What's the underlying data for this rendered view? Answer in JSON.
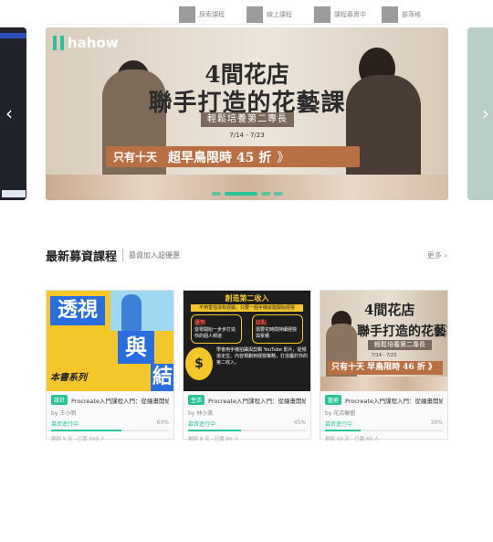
{
  "nav": {
    "items": [
      {
        "label": "探索課程"
      },
      {
        "label": "線上課程"
      },
      {
        "label": "課程募資中"
      },
      {
        "label": "部落格"
      }
    ]
  },
  "carousel": {
    "left_arrow": "‹",
    "right_arrow": "›",
    "banner": {
      "logo": "hahow",
      "title_line1": "4間花店",
      "title_line2": "聯手打造的花藝課",
      "subtitle": "輕鬆培養第二專長",
      "date": "7/14 - 7/23",
      "promo_bubble": "只有十天",
      "promo_main": "超早鳥限時 45 折",
      "promo_chevron": "》"
    }
  },
  "section": {
    "title": "最新募資課程",
    "subtitle": "募資加入超優惠",
    "more": "更多",
    "more_icon": "›"
  },
  "cards": [
    {
      "thumb_text1": "透視",
      "thumb_text2": "與",
      "thumb_text3": "結",
      "thumb_sig": "本書系列",
      "tag": "設計",
      "title": "Procreate入門課程入門：從繪畫開始的",
      "author": "by 王小明",
      "status": "募資進行中",
      "percent_text": "60%",
      "progress": 0.6,
      "footer": "剩餘 5 天 · 已募 100 人"
    },
    {
      "thumb_header": "創造第二收入",
      "thumb_band": "不用害怕沒有經驗，只要一個手機就能開始經營",
      "thumb_box1_title": "優勢",
      "thumb_box1_text": "從零開始一步步打造你的個人頻道",
      "thumb_box2_title": "缺點",
      "thumb_box2_text": "需要花時間持續經營與累積",
      "thumb_coin": "$",
      "thumb_body": "學會用手機拍攝與剪輯 YouTube 影片，從頻道定位、內容規劃到經營策略，打造屬於你的第二收入。",
      "tag": "生活",
      "title": "Procreate入門課程入門：從繪畫開始的",
      "author": "by 林小美",
      "status": "募資進行中",
      "percent_text": "45%",
      "progress": 0.45,
      "footer": "剩餘 8 天 · 已募 80 人"
    },
    {
      "thumb_title1": "4間花店",
      "thumb_title2": "聯手打造的花藝課",
      "thumb_sub": "輕鬆培養第二專長",
      "thumb_date": "7/14 - 7/23",
      "thumb_promo": "只有十天 早鳥限時 46 折 》",
      "tag": "藝術",
      "title": "Procreate入門課程入門：從繪畫開始的",
      "author": "by 花店聯盟",
      "status": "募資進行中",
      "percent_text": "30%",
      "progress": 0.3,
      "footer": "剩餘 10 天 · 已募 60 人"
    }
  ],
  "colors": {
    "accent": "#2dc39a",
    "promo": "#b86f44",
    "nav_square": "#9b9b9b"
  }
}
